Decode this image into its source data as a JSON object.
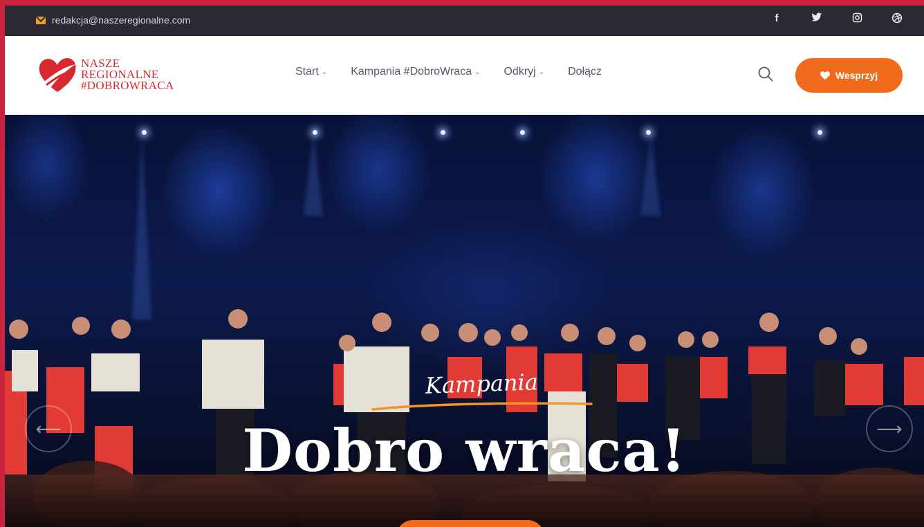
{
  "topbar": {
    "email": "redakcja@naszeregionalne.com",
    "social": [
      "facebook-icon",
      "twitter-icon",
      "instagram-icon",
      "dribbble-icon"
    ]
  },
  "logo": {
    "line1": "NASZE",
    "line2": "REGIONALNE",
    "line3": "#DOBROWRACA"
  },
  "nav": {
    "start": "Start",
    "kampania": "Kampania #DobroWraca",
    "odkryj": "Odkryj",
    "dolacz": "Dołącz"
  },
  "header": {
    "support_label": "Wesprzyj"
  },
  "hero": {
    "kicker": "Kampania",
    "title": "Dobro wraca!"
  },
  "colors": {
    "accent": "#f26b1d",
    "brand_red": "#d62a2e",
    "topbar": "#2b2a33",
    "frame": "#c8233f"
  }
}
